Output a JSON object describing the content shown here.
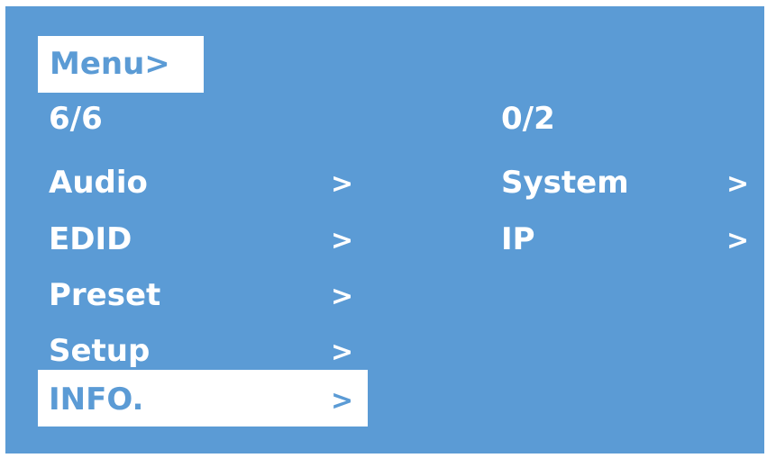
{
  "menu_title": "Menu>",
  "left_panel": {
    "count": "6/6",
    "items": [
      {
        "label": "Audio",
        "arrow": ">"
      },
      {
        "label": "EDID",
        "arrow": ">"
      },
      {
        "label": "Preset",
        "arrow": ">"
      },
      {
        "label": "Setup",
        "arrow": ">"
      },
      {
        "label": "INFO.",
        "arrow": ">",
        "selected": true
      }
    ]
  },
  "right_panel": {
    "count": "0/2",
    "items": [
      {
        "label": "System",
        "arrow": ">"
      },
      {
        "label": "IP",
        "arrow": ">"
      }
    ]
  },
  "colors": {
    "background": "#5b9bd5",
    "highlight": "#ffffff",
    "text": "#ffffff"
  }
}
